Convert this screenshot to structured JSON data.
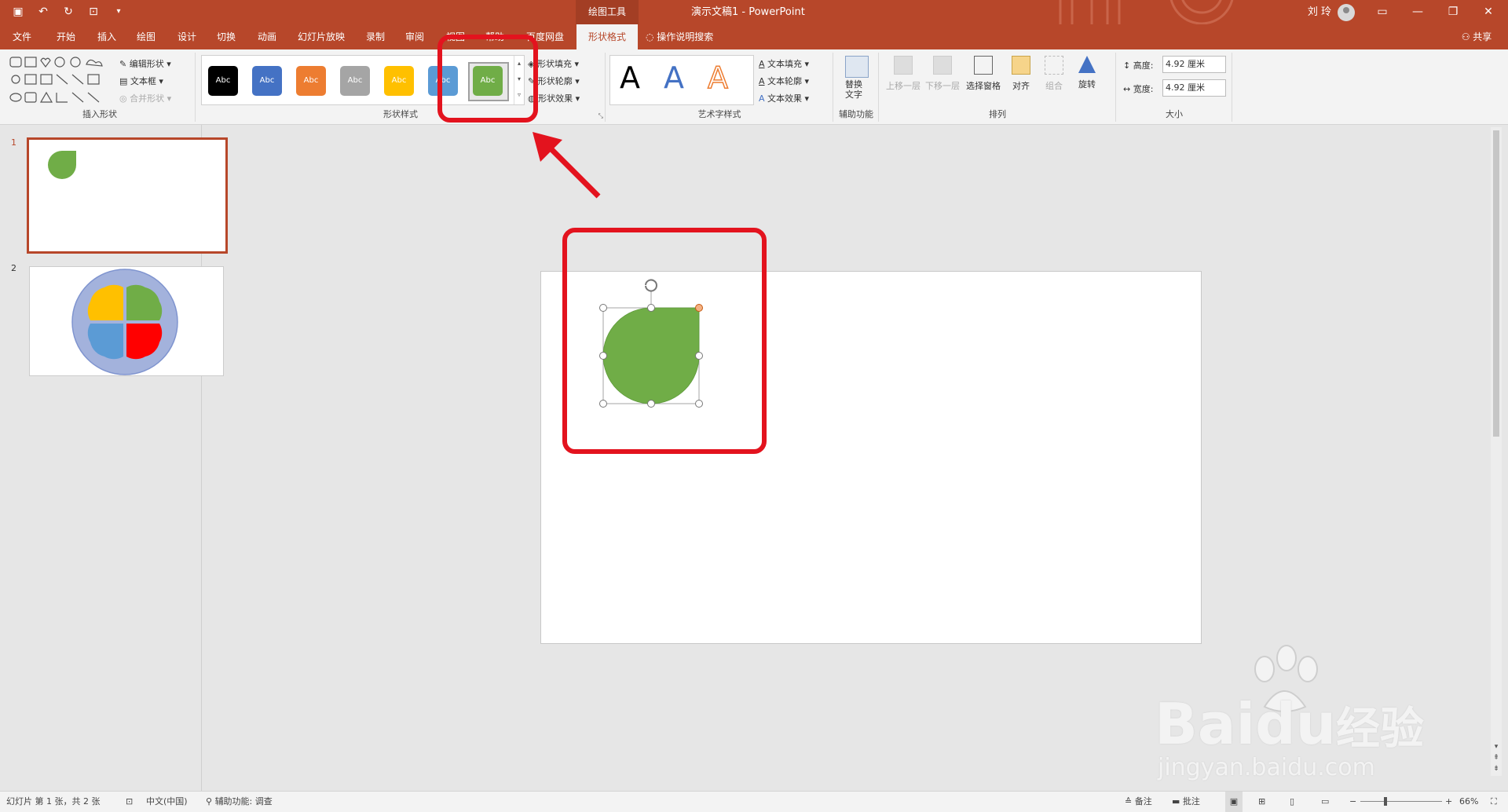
{
  "titlebar": {
    "context_tool": "绘图工具",
    "document_title": "演示文稿1  -  PowerPoint",
    "user_name": "刘 玲"
  },
  "tabs": [
    {
      "label": "文件"
    },
    {
      "label": "开始"
    },
    {
      "label": "插入"
    },
    {
      "label": "绘图"
    },
    {
      "label": "设计"
    },
    {
      "label": "切换"
    },
    {
      "label": "动画"
    },
    {
      "label": "幻灯片放映"
    },
    {
      "label": "录制"
    },
    {
      "label": "审阅"
    },
    {
      "label": "视图"
    },
    {
      "label": "帮助"
    },
    {
      "label": "百度网盘"
    },
    {
      "label": "形状格式"
    }
  ],
  "search_label": "操作说明搜索",
  "share_label": "共享",
  "ribbon": {
    "insert_shapes": {
      "label": "插入形状",
      "edit_shape": "编辑形状",
      "text_box": "文本框",
      "merge_shapes": "合并形状"
    },
    "shape_styles": {
      "label": "形状样式",
      "sample_text": "Abc",
      "swatches": [
        "#000000",
        "#4472c4",
        "#ed7d31",
        "#a5a5a5",
        "#ffc000",
        "#5b9bd5",
        "#70ad47"
      ],
      "fill": "形状填充",
      "outline": "形状轮廓",
      "effects": "形状效果"
    },
    "wordart": {
      "label": "艺术字样式",
      "letter": "A",
      "fill": "文本填充",
      "outline": "文本轮廓",
      "effects": "文本效果"
    },
    "accessibility": {
      "label": "辅助功能",
      "alt_text_1": "替换",
      "alt_text_2": "文字"
    },
    "arrange": {
      "label": "排列",
      "bring_forward": "上移一层",
      "send_backward": "下移一层",
      "selection_pane": "选择窗格",
      "align": "对齐",
      "group": "组合",
      "rotate": "旋转"
    },
    "size": {
      "label": "大小",
      "height_label": "高度:",
      "height_value": "4.92 厘米",
      "width_label": "宽度:",
      "width_value": "4.92 厘米"
    }
  },
  "thumbnails": [
    {
      "number": "1"
    },
    {
      "number": "2"
    }
  ],
  "colors": {
    "accent": "#b7472a",
    "shape_green": "#70ad47",
    "highlight_red": "#e3131e"
  },
  "statusbar": {
    "slide_info": "幻灯片 第 1 张，共 2 张",
    "language": "中文(中国)",
    "accessibility": "辅助功能: 调查",
    "notes": "备注",
    "comments": "批注",
    "zoom": "66%"
  },
  "watermark": {
    "brand": "Bai",
    "brand2": "du",
    "cn": "经验",
    "url": "jingyan.baidu.com"
  }
}
